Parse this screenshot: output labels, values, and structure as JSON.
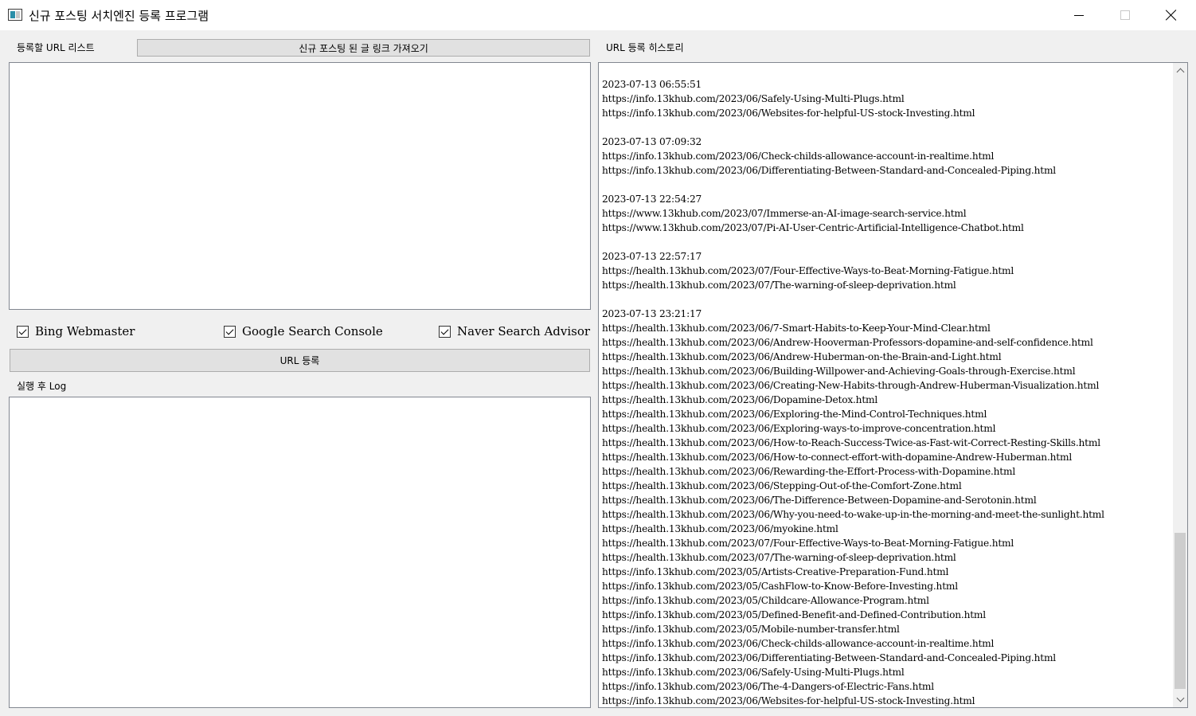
{
  "window": {
    "title": "신규 포스팅 서치엔진 등록 프로그램"
  },
  "left": {
    "url_list_label": "등록할 URL 리스트",
    "fetch_button_label": "신규 포스팅 된 글 링크 가져오기",
    "url_list_value": "",
    "checkboxes": [
      {
        "label": "Bing Webmaster",
        "checked": true
      },
      {
        "label": "Google Search Console",
        "checked": true
      },
      {
        "label": "Naver Search Advisor",
        "checked": true
      }
    ],
    "register_button_label": "URL 등록",
    "log_label": "실행 후 Log",
    "log_value": ""
  },
  "right": {
    "history_label": "URL 등록 히스토리",
    "history_lines": [
      "2023-07-13 06:55:51",
      "https://info.13khub.com/2023/06/Safely-Using-Multi-Plugs.html",
      "https://info.13khub.com/2023/06/Websites-for-helpful-US-stock-Investing.html",
      "",
      "2023-07-13 07:09:32",
      "https://info.13khub.com/2023/06/Check-childs-allowance-account-in-realtime.html",
      "https://info.13khub.com/2023/06/Differentiating-Between-Standard-and-Concealed-Piping.html",
      "",
      "2023-07-13 22:54:27",
      "https://www.13khub.com/2023/07/Immerse-an-AI-image-search-service.html",
      "https://www.13khub.com/2023/07/Pi-AI-User-Centric-Artificial-Intelligence-Chatbot.html",
      "",
      "2023-07-13 22:57:17",
      "https://health.13khub.com/2023/07/Four-Effective-Ways-to-Beat-Morning-Fatigue.html",
      "https://health.13khub.com/2023/07/The-warning-of-sleep-deprivation.html",
      "",
      "2023-07-13 23:21:17",
      "https://health.13khub.com/2023/06/7-Smart-Habits-to-Keep-Your-Mind-Clear.html",
      "https://health.13khub.com/2023/06/Andrew-Hooverman-Professors-dopamine-and-self-confidence.html",
      "https://health.13khub.com/2023/06/Andrew-Huberman-on-the-Brain-and-Light.html",
      "https://health.13khub.com/2023/06/Building-Willpower-and-Achieving-Goals-through-Exercise.html",
      "https://health.13khub.com/2023/06/Creating-New-Habits-through-Andrew-Huberman-Visualization.html",
      "https://health.13khub.com/2023/06/Dopamine-Detox.html",
      "https://health.13khub.com/2023/06/Exploring-the-Mind-Control-Techniques.html",
      "https://health.13khub.com/2023/06/Exploring-ways-to-improve-concentration.html",
      "https://health.13khub.com/2023/06/How-to-Reach-Success-Twice-as-Fast-wit-Correct-Resting-Skills.html",
      "https://health.13khub.com/2023/06/How-to-connect-effort-with-dopamine-Andrew-Huberman.html",
      "https://health.13khub.com/2023/06/Rewarding-the-Effort-Process-with-Dopamine.html",
      "https://health.13khub.com/2023/06/Stepping-Out-of-the-Comfort-Zone.html",
      "https://health.13khub.com/2023/06/The-Difference-Between-Dopamine-and-Serotonin.html",
      "https://health.13khub.com/2023/06/Why-you-need-to-wake-up-in-the-morning-and-meet-the-sunlight.html",
      "https://health.13khub.com/2023/06/myokine.html",
      "https://health.13khub.com/2023/07/Four-Effective-Ways-to-Beat-Morning-Fatigue.html",
      "https://health.13khub.com/2023/07/The-warning-of-sleep-deprivation.html",
      "https://info.13khub.com/2023/05/Artists-Creative-Preparation-Fund.html",
      "https://info.13khub.com/2023/05/CashFlow-to-Know-Before-Investing.html",
      "https://info.13khub.com/2023/05/Childcare-Allowance-Program.html",
      "https://info.13khub.com/2023/05/Defined-Benefit-and-Defined-Contribution.html",
      "https://info.13khub.com/2023/05/Mobile-number-transfer.html",
      "https://info.13khub.com/2023/06/Check-childs-allowance-account-in-realtime.html",
      "https://info.13khub.com/2023/06/Differentiating-Between-Standard-and-Concealed-Piping.html",
      "https://info.13khub.com/2023/06/Safely-Using-Multi-Plugs.html",
      "https://info.13khub.com/2023/06/The-4-Dangers-of-Electric-Fans.html",
      "https://info.13khub.com/2023/06/Websites-for-helpful-US-stock-Investing.html"
    ]
  }
}
